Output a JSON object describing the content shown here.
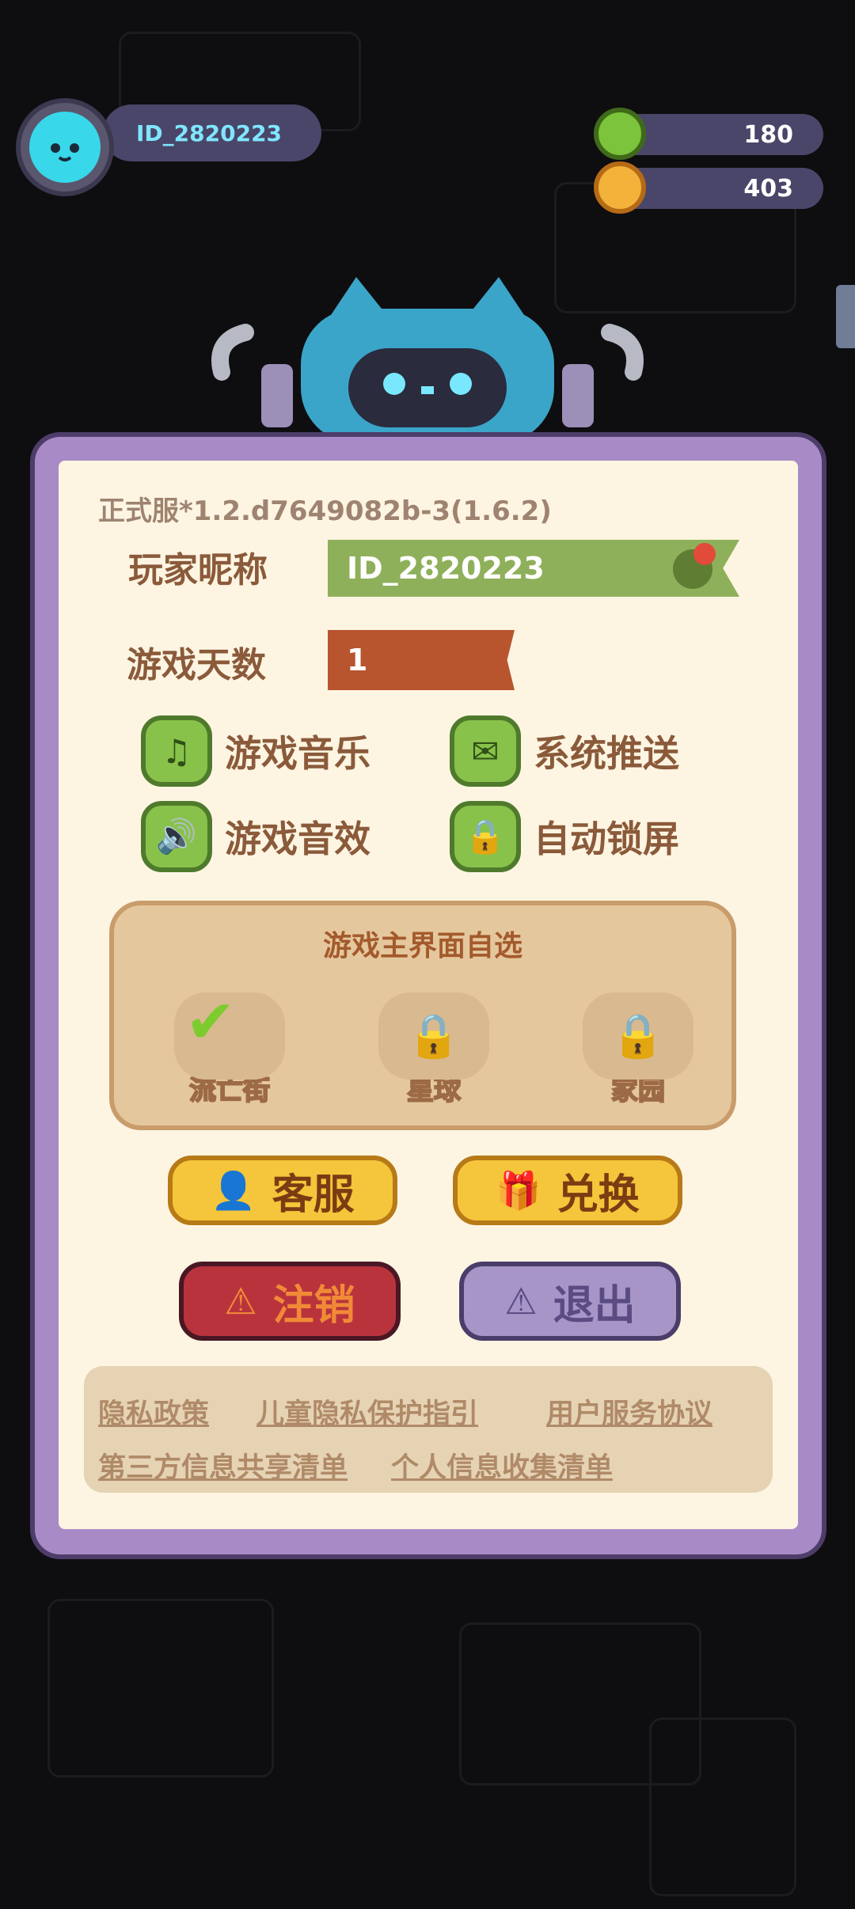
{
  "header": {
    "player_id": "ID_2820223",
    "currency_green": "180",
    "currency_gold": "403"
  },
  "panel": {
    "version": "正式服*1.2.d7649082b-3(1.6.2)",
    "nickname_label": "玩家昵称",
    "nickname_value": "ID_2820223",
    "days_label": "游戏天数",
    "days_value": "1",
    "toggles": [
      {
        "label": "游戏音乐",
        "icon": "music-note-icon"
      },
      {
        "label": "系统推送",
        "icon": "message-icon"
      },
      {
        "label": "游戏音效",
        "icon": "speaker-icon"
      },
      {
        "label": "自动锁屏",
        "icon": "lock-icon"
      }
    ],
    "home_select": {
      "title": "游戏主界面自选",
      "modes": [
        {
          "label": "流亡街",
          "state": "selected"
        },
        {
          "label": "星球",
          "state": "locked"
        },
        {
          "label": "家园",
          "state": "locked"
        }
      ]
    },
    "buttons": {
      "service": "客服",
      "redeem": "兑换",
      "cancel_account": "注销",
      "logout": "退出"
    },
    "links": {
      "privacy": "隐私政策",
      "child_privacy": "儿童隐私保护指引",
      "user_agreement": "用户服务协议",
      "third_party": "第三方信息共享清单",
      "personal_info": "个人信息收集清单"
    }
  },
  "colors": {
    "panel_frame": "#a88bc6",
    "panel_bg": "#fdf5e2",
    "nickname_bg": "#8fb05a",
    "days_bg": "#b8552e",
    "toggle_green": "#88c24a",
    "gold_button": "#f5c53b",
    "red_button": "#b9333d",
    "purple_button": "#a795c8"
  }
}
